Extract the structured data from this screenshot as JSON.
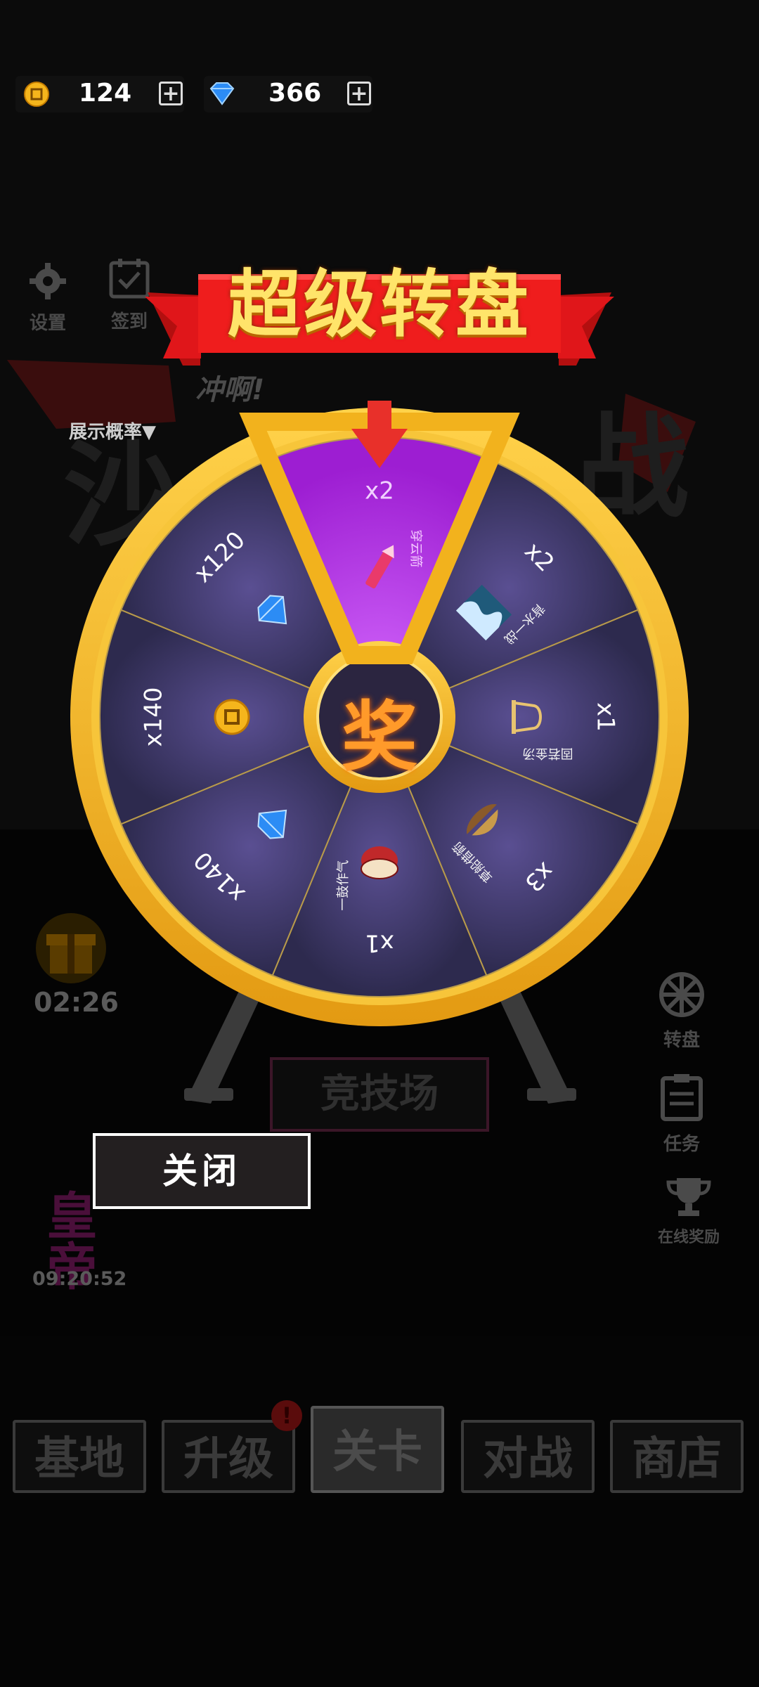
{
  "currency": {
    "coins": "124",
    "gems": "366",
    "coin_icon": "coin-icon",
    "gem_icon": "diamond-icon",
    "plus_label": "+"
  },
  "top_menu": {
    "settings": "设置",
    "checkin": "签到"
  },
  "show_probability": "展示概率▼",
  "chong_a": "冲啊!",
  "banner": {
    "title": "超级转盘"
  },
  "wheel": {
    "center_label": "奖",
    "segments": [
      {
        "amount": "x2",
        "item": "穿云箭",
        "icon": "firework-icon",
        "highlighted": true
      },
      {
        "amount": "x2",
        "item": "背水一战",
        "icon": "wave-icon"
      },
      {
        "amount": "x1",
        "item": "固若金汤",
        "icon": "bell-icon"
      },
      {
        "amount": "x3",
        "item": "草船借箭",
        "icon": "boat-icon"
      },
      {
        "amount": "x1",
        "item": "一鼓作气",
        "icon": "drum-icon"
      },
      {
        "amount": "x140",
        "item": "",
        "icon": "diamond-icon"
      },
      {
        "amount": "x140",
        "item": "",
        "icon": "coin-icon"
      },
      {
        "amount": "x120",
        "item": "",
        "icon": "diamond-icon"
      }
    ],
    "colors": {
      "rim": "#f2b21d",
      "segment": "#3b3566",
      "highlight": "#b52fe0",
      "pointer": "#e8302a"
    }
  },
  "timer_gift": "02:26",
  "timer_emperor": "09:20:52",
  "emperor_label": "皇帝",
  "close_button": "关闭",
  "arena_button": "竞技场",
  "side_menu": {
    "wheel": "转盘",
    "tasks": "任务",
    "online_reward": "在线奖励"
  },
  "bottom_nav": [
    {
      "label": "基地"
    },
    {
      "label": "升级",
      "badge": "!"
    },
    {
      "label": "关卡",
      "active": true
    },
    {
      "label": "对战"
    },
    {
      "label": "商店"
    }
  ]
}
